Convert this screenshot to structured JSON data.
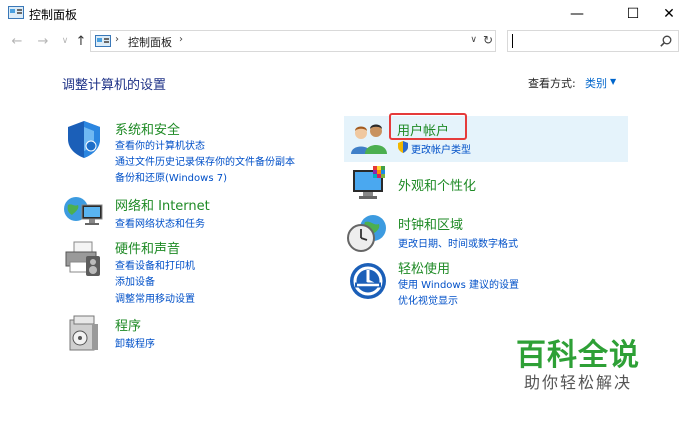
{
  "window": {
    "title": "控制面板",
    "minimize_glyph": "—",
    "maximize_glyph": "☐",
    "close_glyph": "✕"
  },
  "address": {
    "separator": "›",
    "location": "控制面板",
    "dropdown_glyph": "∨",
    "refresh_glyph": "↻"
  },
  "nav": {
    "back_glyph": "←",
    "forward_glyph": "→",
    "recent_glyph": "∨",
    "up_glyph": "↑"
  },
  "search": {
    "placeholder": ""
  },
  "header": {
    "title": "调整计算机的设置",
    "view_by_label": "查看方式:",
    "view_by_value": "类别",
    "view_by_caret": "▼"
  },
  "left_categories": [
    {
      "title": "系统和安全",
      "icon": "shield-icon",
      "links": [
        "查看你的计算机状态",
        "通过文件历史记录保存你的文件备份副本",
        "备份和还原(Windows 7)"
      ]
    },
    {
      "title": "网络和 Internet",
      "icon": "network-globe-icon",
      "links": [
        "查看网络状态和任务"
      ]
    },
    {
      "title": "硬件和声音",
      "icon": "printer-icon",
      "links": [
        "查看设备和打印机",
        "添加设备",
        "调整常用移动设置"
      ]
    },
    {
      "title": "程序",
      "icon": "programs-icon",
      "links": [
        "卸载程序"
      ]
    }
  ],
  "right_categories": [
    {
      "title": "用户帐户",
      "icon": "users-icon",
      "links": [
        "更改帐户类型"
      ]
    },
    {
      "title": "外观和个性化",
      "icon": "monitor-palette-icon",
      "links": []
    },
    {
      "title": "时钟和区域",
      "icon": "clock-globe-icon",
      "links": [
        "更改日期、时间或数字格式"
      ]
    },
    {
      "title": "轻松使用",
      "icon": "accessibility-icon",
      "links": [
        "使用 Windows 建议的设置",
        "优化视觉显示"
      ]
    }
  ],
  "colors": {
    "category_title": "#1e8a25",
    "link": "#0050c8",
    "heading": "#1e3287",
    "highlight_bg": "#e5f3fb",
    "callout": "#e53b3b"
  },
  "watermark": {
    "brand": "百科全说",
    "tagline": "助你轻松解决"
  }
}
